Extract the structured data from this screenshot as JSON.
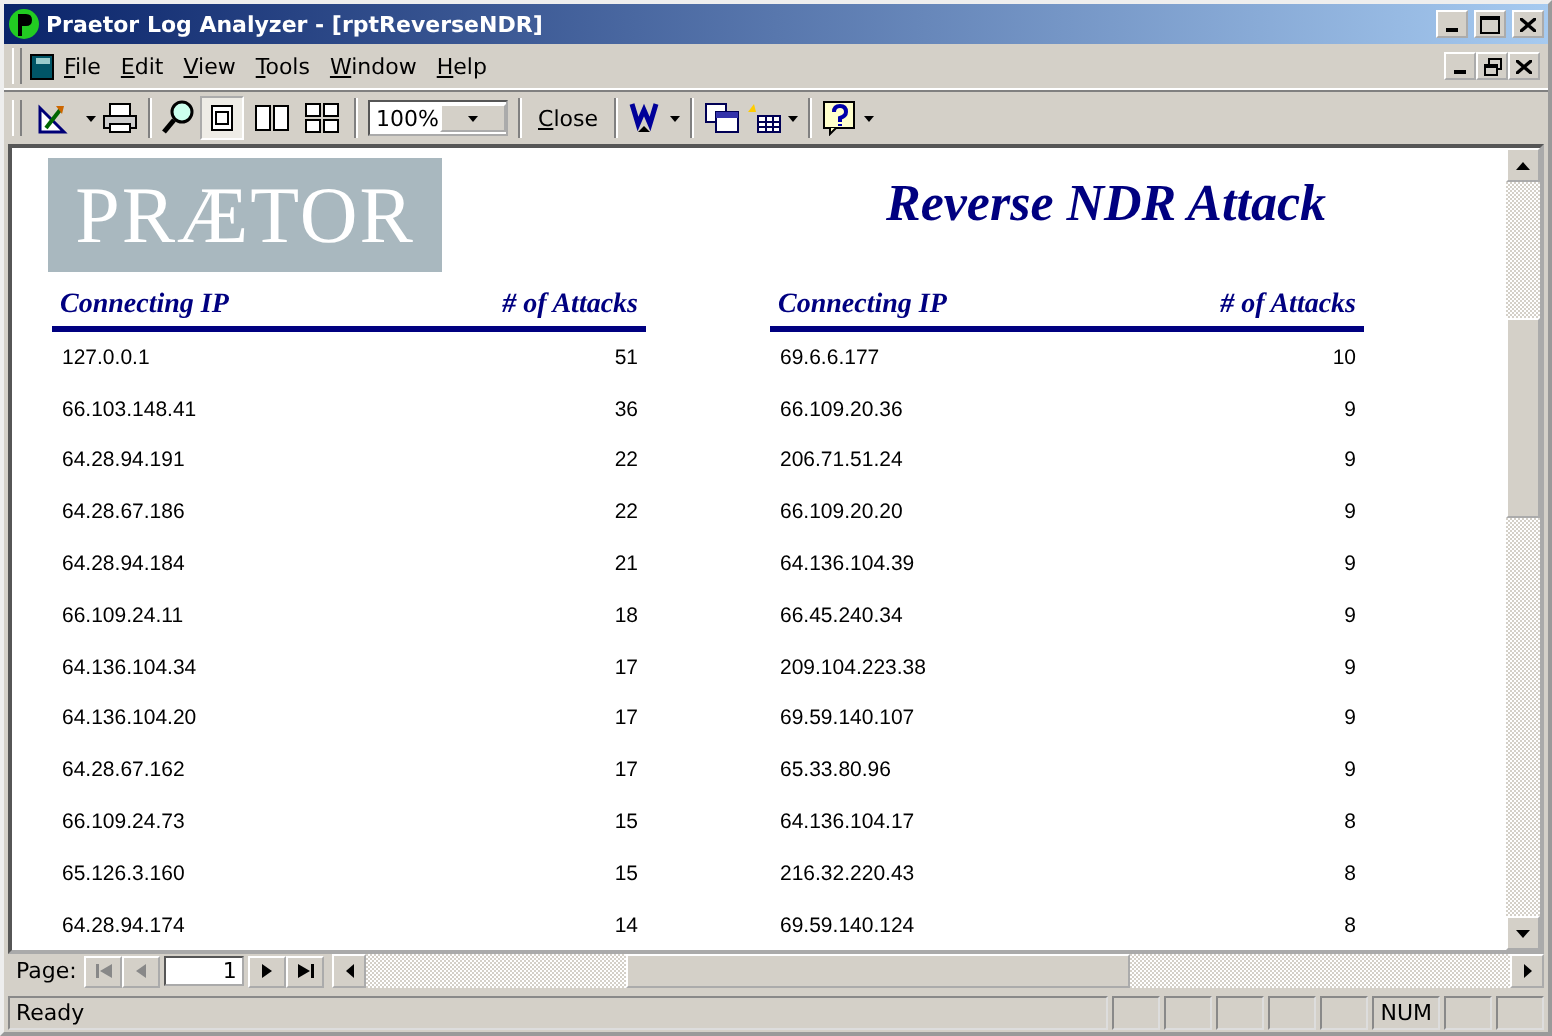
{
  "window": {
    "title": "Praetor Log Analyzer - [rptReverseNDR]"
  },
  "menu": [
    {
      "label": "File"
    },
    {
      "label": "Edit"
    },
    {
      "label": "View"
    },
    {
      "label": "Tools"
    },
    {
      "label": "Window"
    },
    {
      "label": "Help"
    }
  ],
  "toolbar": {
    "zoom": "100%",
    "close": "Close",
    "page_views": [
      {
        "kind": "one",
        "selected": true
      },
      {
        "kind": "two",
        "selected": false
      },
      {
        "kind": "four",
        "selected": false
      }
    ]
  },
  "report": {
    "logo": "PRÆTOR",
    "title": "Reverse NDR Attack",
    "tables": [
      {
        "columns": [
          "Connecting IP",
          "# of Attacks"
        ],
        "rows": [
          [
            "127.0.0.1",
            "51"
          ],
          [
            "66.103.148.41",
            "36"
          ],
          [
            "64.28.94.191",
            "22"
          ],
          [
            "64.28.67.186",
            "22"
          ],
          [
            "64.28.94.184",
            "21"
          ],
          [
            "66.109.24.11",
            "18"
          ],
          [
            "64.136.104.34",
            "17"
          ],
          [
            "64.136.104.20",
            "17"
          ],
          [
            "64.28.67.162",
            "17"
          ],
          [
            "66.109.24.73",
            "15"
          ],
          [
            "65.126.3.160",
            "15"
          ],
          [
            "64.28.94.174",
            "14"
          ]
        ]
      },
      {
        "columns": [
          "Connecting IP",
          "# of Attacks"
        ],
        "rows": [
          [
            "69.6.6.177",
            "10"
          ],
          [
            "66.109.20.36",
            "9"
          ],
          [
            "206.71.51.24",
            "9"
          ],
          [
            "66.109.20.20",
            "9"
          ],
          [
            "64.136.104.39",
            "9"
          ],
          [
            "66.45.240.34",
            "9"
          ],
          [
            "209.104.223.38",
            "9"
          ],
          [
            "69.59.140.107",
            "9"
          ],
          [
            "65.33.80.96",
            "9"
          ],
          [
            "64.136.104.17",
            "8"
          ],
          [
            "216.32.220.43",
            "8"
          ],
          [
            "69.59.140.124",
            "8"
          ]
        ]
      }
    ]
  },
  "navigation": {
    "label": "Page:",
    "page": "1"
  },
  "status_bar": {
    "text": "Ready",
    "indicator": "NUM"
  }
}
